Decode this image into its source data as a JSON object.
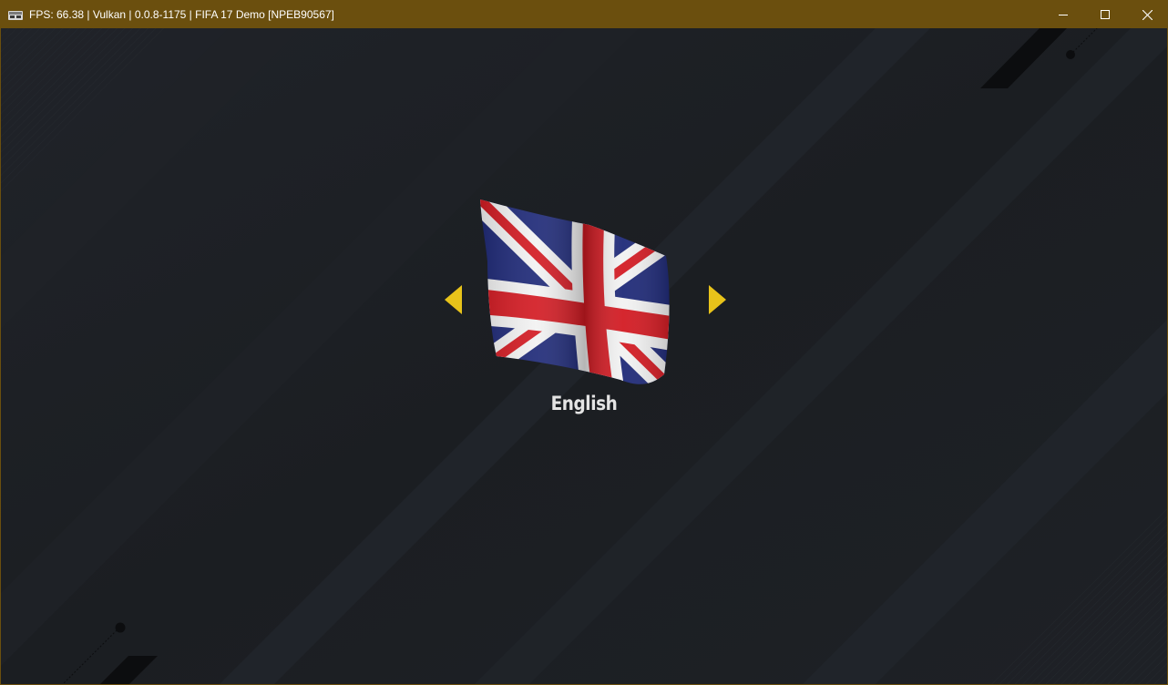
{
  "window": {
    "title": "FPS: 66.38 | Vulkan | 0.0.8-1175 | FIFA 17 Demo [NPEB90567]",
    "app_icon": "rpcs3-icon",
    "controls": [
      "minimize-icon",
      "maximize-icon",
      "close-icon"
    ],
    "frame_color": "#6b4f0e"
  },
  "language_select": {
    "selected_language": "English",
    "flag": "union-jack-flag",
    "prev_icon": "arrow-left-icon",
    "next_icon": "arrow-right-icon",
    "arrow_color": "#e8c31a"
  },
  "colors": {
    "background": "#1b1e22",
    "stripe": "#22262b",
    "text": "#e4e4e4"
  }
}
